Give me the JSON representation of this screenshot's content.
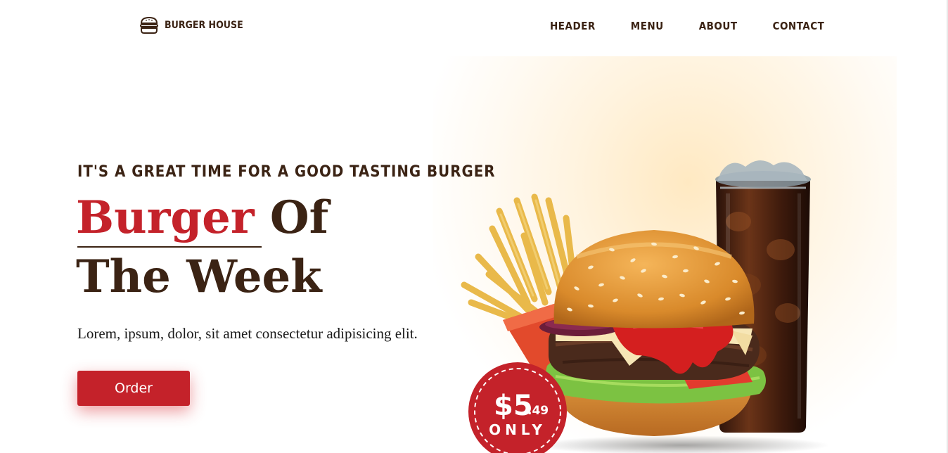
{
  "brand": {
    "name": "BURGER HOUSE",
    "icon": "burger-icon"
  },
  "nav": {
    "items": [
      "HEADER",
      "MENU",
      "ABOUT",
      "CONTACT"
    ]
  },
  "hero": {
    "tagline": "IT'S A GREAT TIME FOR A GOOD TASTING BURGER",
    "title_highlight": "Burger",
    "title_rest": "Of",
    "title_line2": "The Week",
    "description": "Lorem, ipsum, dolor, sit amet consectetur adipisicing elit.",
    "order_label": "Order"
  },
  "price_badge": {
    "dollars": "$5",
    "cents": ".49",
    "suffix": "ONLY"
  },
  "colors": {
    "accent": "#c4222a",
    "text": "#3b2314"
  }
}
